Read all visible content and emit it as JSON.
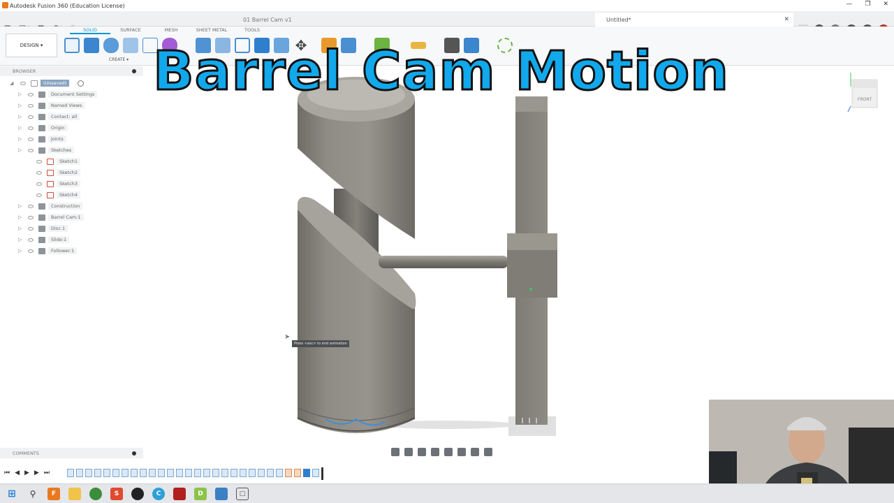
{
  "window": {
    "title": "Autodesk Fusion 360 (Education License)"
  },
  "tabs": [
    {
      "label": "01 Barrel Cam v1"
    },
    {
      "label": "Untitled*"
    }
  ],
  "workspace_tabs": [
    "SOLID",
    "SURFACE",
    "MESH",
    "SHEET METAL",
    "TOOLS"
  ],
  "toolbar": {
    "workspace_button": "DESIGN ▾",
    "create_label": "CREATE ▾"
  },
  "browser": {
    "header": "BROWSER",
    "root": "(Unsaved)",
    "items": [
      {
        "label": "Document Settings",
        "indent": 1
      },
      {
        "label": "Named Views",
        "indent": 1
      },
      {
        "label": "Contact: all",
        "indent": 1
      },
      {
        "label": "Origin",
        "indent": 1
      },
      {
        "label": "Joints",
        "indent": 1
      },
      {
        "label": "Sketches",
        "indent": 1
      },
      {
        "label": "Sketch1",
        "indent": 2
      },
      {
        "label": "Sketch2",
        "indent": 2
      },
      {
        "label": "Sketch3",
        "indent": 2
      },
      {
        "label": "Sketch4",
        "indent": 2
      },
      {
        "label": "Construction",
        "indent": 1
      },
      {
        "label": "Barrel Cam:1",
        "indent": 1
      },
      {
        "label": "Disc:1",
        "indent": 1
      },
      {
        "label": "Slide:1",
        "indent": 1
      },
      {
        "label": "Follower:1",
        "indent": 1
      }
    ]
  },
  "comments": {
    "label": "COMMENTS"
  },
  "headline": "Barrel Cam Motion",
  "tooltip": "Press <esc> to end animation",
  "viewcube": {
    "face": "FRONT"
  },
  "colors": {
    "accent": "#0696d7",
    "headline": "#12a8ec",
    "model": "#8a877f"
  },
  "icons": [
    "grid-icon",
    "file-icon",
    "save-icon",
    "undo-icon",
    "redo-icon",
    "play-icon",
    "windows-icon",
    "search-icon"
  ]
}
